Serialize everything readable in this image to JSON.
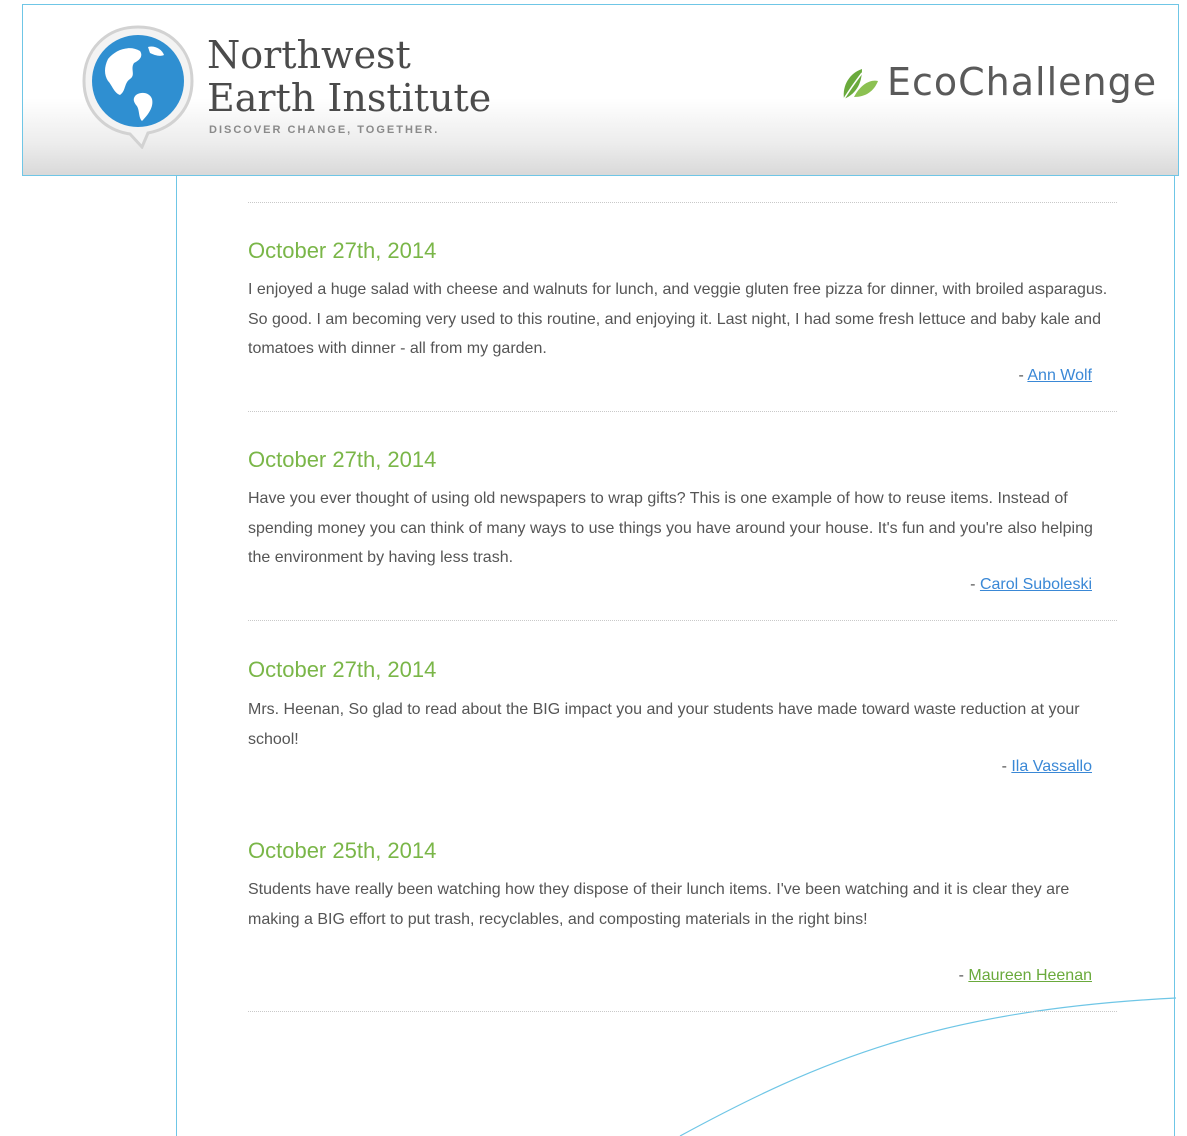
{
  "header": {
    "org_name_line1": "Northwest",
    "org_name_line2": "Earth Institute",
    "tagline": "DISCOVER CHANGE, TOGETHER.",
    "program_name": "EcoChallenge",
    "logo_icon": "globe-speech-bubble-icon",
    "program_icon": "leaf-icon"
  },
  "colors": {
    "date_green": "#7ab648",
    "link_blue": "#3a88d6",
    "link_green": "#6aaa3c",
    "frame_blue": "#6fc6e6"
  },
  "entries": [
    {
      "date": "October 27th, 2014",
      "text": "I enjoyed a huge salad with cheese and walnuts for lunch, and veggie gluten free pizza for dinner, with broiled asparagus. So good. I am becoming very used to this routine, and enjoying it. Last night, I had some fresh lettuce and baby kale and tomatoes with dinner - all from my garden.",
      "author_prefix": "- ",
      "author": "Ann Wolf"
    },
    {
      "date": "October 27th, 2014",
      "text": "Have you ever thought of using old newspapers to wrap gifts? This is one example of how to reuse items. Instead of spending money you can think of many ways to use things you have around your house. It's fun and you're also helping the environment by having less trash.",
      "author_prefix": "- ",
      "author": "Carol Suboleski"
    },
    {
      "date": "October 27th, 2014",
      "text": "Mrs. Heenan, So glad to read about the BIG impact you and your students have made toward waste reduction at your school!",
      "author_prefix": "- ",
      "author": "Ila Vassallo"
    },
    {
      "date": "October 25th, 2014",
      "text": "Students have really been watching how they dispose of their lunch items. I've been watching and it is clear they are making a BIG effort to put trash, recyclables, and composting materials in the right bins!",
      "author_prefix": "- ",
      "author": "Maureen Heenan"
    }
  ]
}
